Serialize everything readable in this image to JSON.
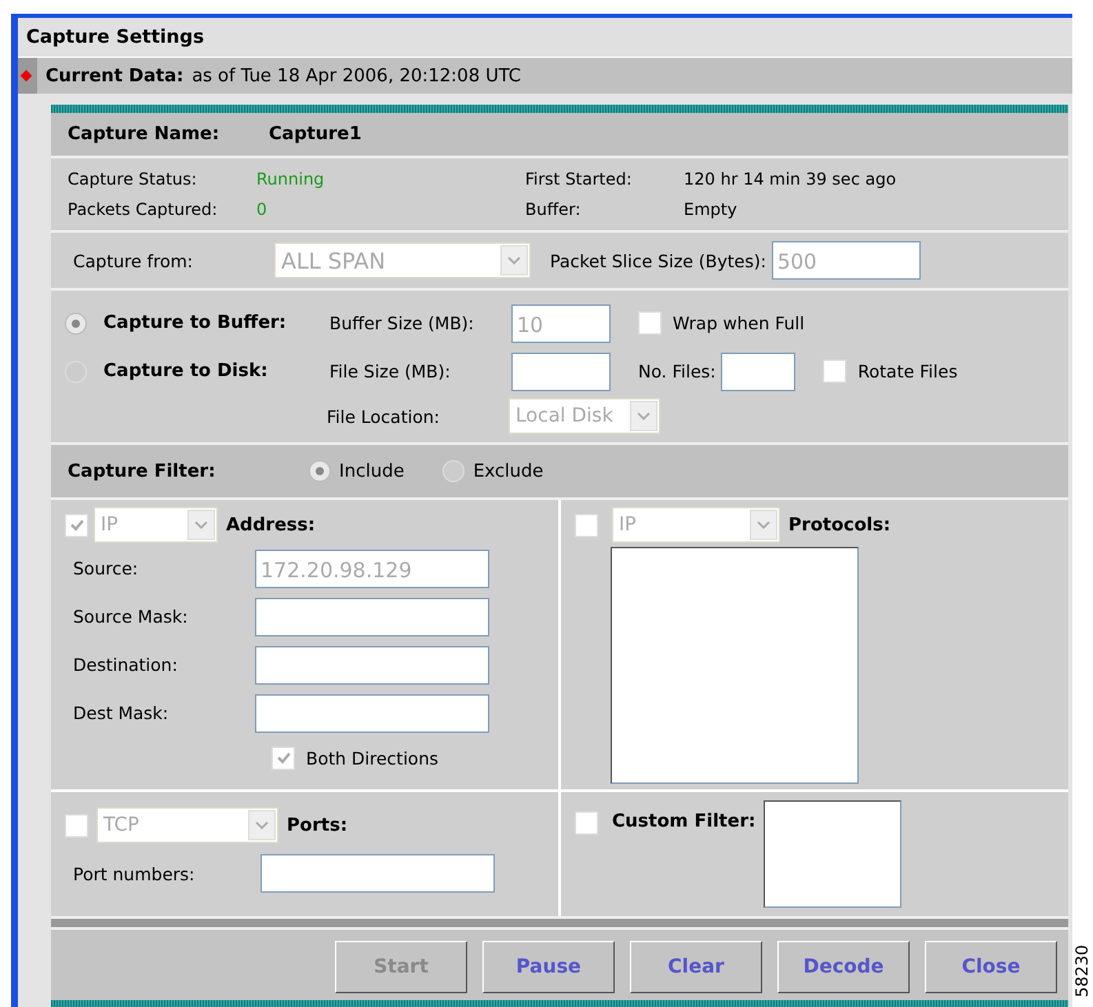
{
  "title": "Capture Settings",
  "current_data": {
    "label": "Current Data:",
    "value": "as of Tue 18 Apr 2006, 20:12:08 UTC"
  },
  "capture_name": {
    "label": "Capture Name:",
    "value": "Capture1"
  },
  "status": [
    {
      "label": "Capture Status:",
      "value": "Running",
      "color": "#1a9a1a"
    },
    {
      "label": "First Started:",
      "value": "120 hr 14 min 39 sec ago",
      "color": "#000000"
    },
    {
      "label": "Packets Captured:",
      "value": "0",
      "color": "#1a9a1a"
    },
    {
      "label": "Buffer:",
      "value": "Empty",
      "color": "#000000"
    }
  ],
  "capture_from": {
    "label": "Capture from:",
    "value": "ALL SPAN"
  },
  "slice": {
    "label": "Packet Slice Size (Bytes):",
    "value": "500"
  },
  "buffer": {
    "label": "Capture to Buffer:",
    "selected": true,
    "size_label": "Buffer Size (MB):",
    "size_value": "10",
    "wrap_label": "Wrap when Full",
    "wrap_checked": false
  },
  "disk": {
    "label": "Capture to Disk:",
    "selected": false,
    "size_label": "File Size (MB):",
    "files_label": "No. Files:",
    "rotate_label": "Rotate Files",
    "rotate_checked": false,
    "location_label": "File Location:",
    "location_value": "Local Disk"
  },
  "filter": {
    "label": "Capture Filter:",
    "options": [
      {
        "label": "Include",
        "selected": true
      },
      {
        "label": "Exclude",
        "selected": false
      }
    ]
  },
  "address": {
    "checked": true,
    "type": "IP",
    "label": "Address:",
    "fields": [
      {
        "label": "Source:",
        "value": "172.20.98.129"
      },
      {
        "label": "Source Mask:"
      },
      {
        "label": "Destination:"
      },
      {
        "label": "Dest Mask:"
      }
    ],
    "both_label": "Both Directions",
    "both_checked": true
  },
  "protocols": {
    "checked": false,
    "type": "IP",
    "label": "Protocols:"
  },
  "ports": {
    "checked": false,
    "type": "TCP",
    "label": "Ports:",
    "numbers_label": "Port numbers:"
  },
  "custom": {
    "checked": false,
    "label": "Custom Filter:"
  },
  "buttons": [
    {
      "label": "Start",
      "disabled": true
    },
    {
      "label": "Pause",
      "disabled": false
    },
    {
      "label": "Clear",
      "disabled": false
    },
    {
      "label": "Decode",
      "disabled": false
    },
    {
      "label": "Close",
      "disabled": false
    }
  ],
  "figure_id": "58230"
}
